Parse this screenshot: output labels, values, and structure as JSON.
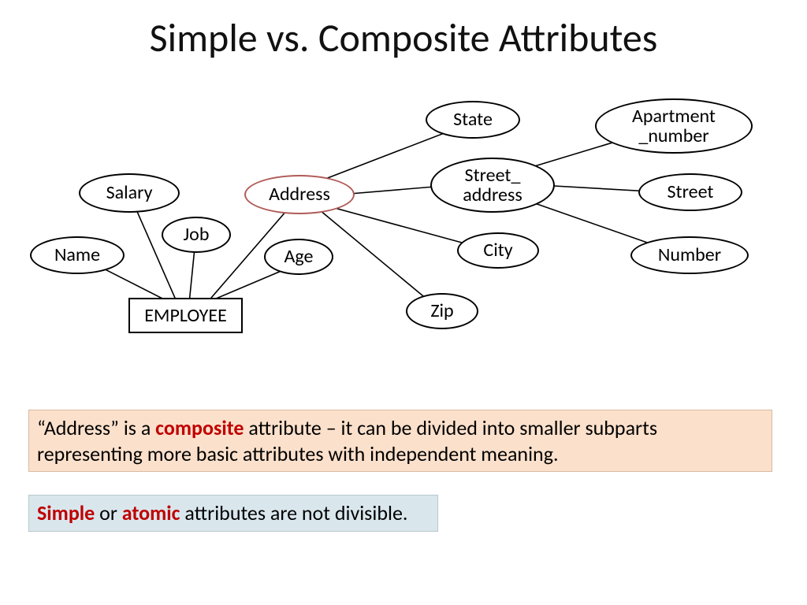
{
  "title": "Simple vs. Composite Attributes",
  "entity": {
    "label": "EMPLOYEE"
  },
  "attrs": {
    "salary": "Salary",
    "name": "Name",
    "job": "Job",
    "age": "Age",
    "address": "Address",
    "state": "State",
    "street_address": "Street_\naddress",
    "city": "City",
    "zip": "Zip",
    "apartment_number": "Apartment\n_number",
    "street": "Street",
    "number": "Number"
  },
  "callout1": {
    "pre": "“Address” is a ",
    "kw": "composite",
    "post": " attribute – it can be divided into smaller subparts representing more basic attributes with independent meaning."
  },
  "callout2": {
    "kw1": "Simple",
    "mid": " or ",
    "kw2": "atomic",
    "post": " attributes are not divisible."
  }
}
